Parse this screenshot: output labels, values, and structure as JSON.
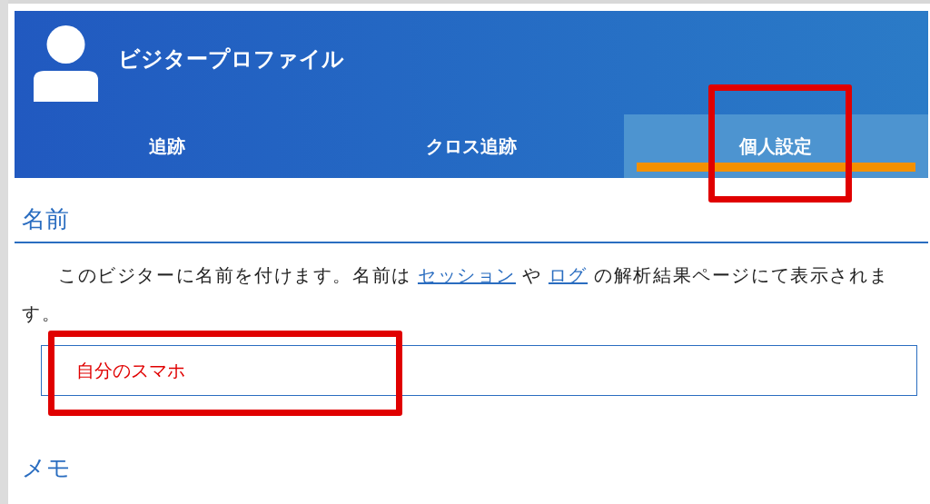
{
  "header": {
    "title": "ビジタープロファイル"
  },
  "tabs": [
    {
      "label": "追跡",
      "selected": false
    },
    {
      "label": "クロス追跡",
      "selected": false
    },
    {
      "label": "個人設定",
      "selected": true
    }
  ],
  "name_section": {
    "heading": "名前",
    "description": [
      {
        "kind": "text",
        "text": "このビジターに名前を付けます。名前は "
      },
      {
        "kind": "link",
        "text": "セッション"
      },
      {
        "kind": "text",
        "text": " や "
      },
      {
        "kind": "link",
        "text": "ログ"
      },
      {
        "kind": "text",
        "text": " の解析結果ページにて表示されます。"
      }
    ],
    "field": {
      "value": "自分のスマホ"
    }
  },
  "memo_section": {
    "heading": "メモ"
  },
  "annotations": [
    {
      "kind": "box"
    },
    {
      "kind": "box"
    }
  ]
}
